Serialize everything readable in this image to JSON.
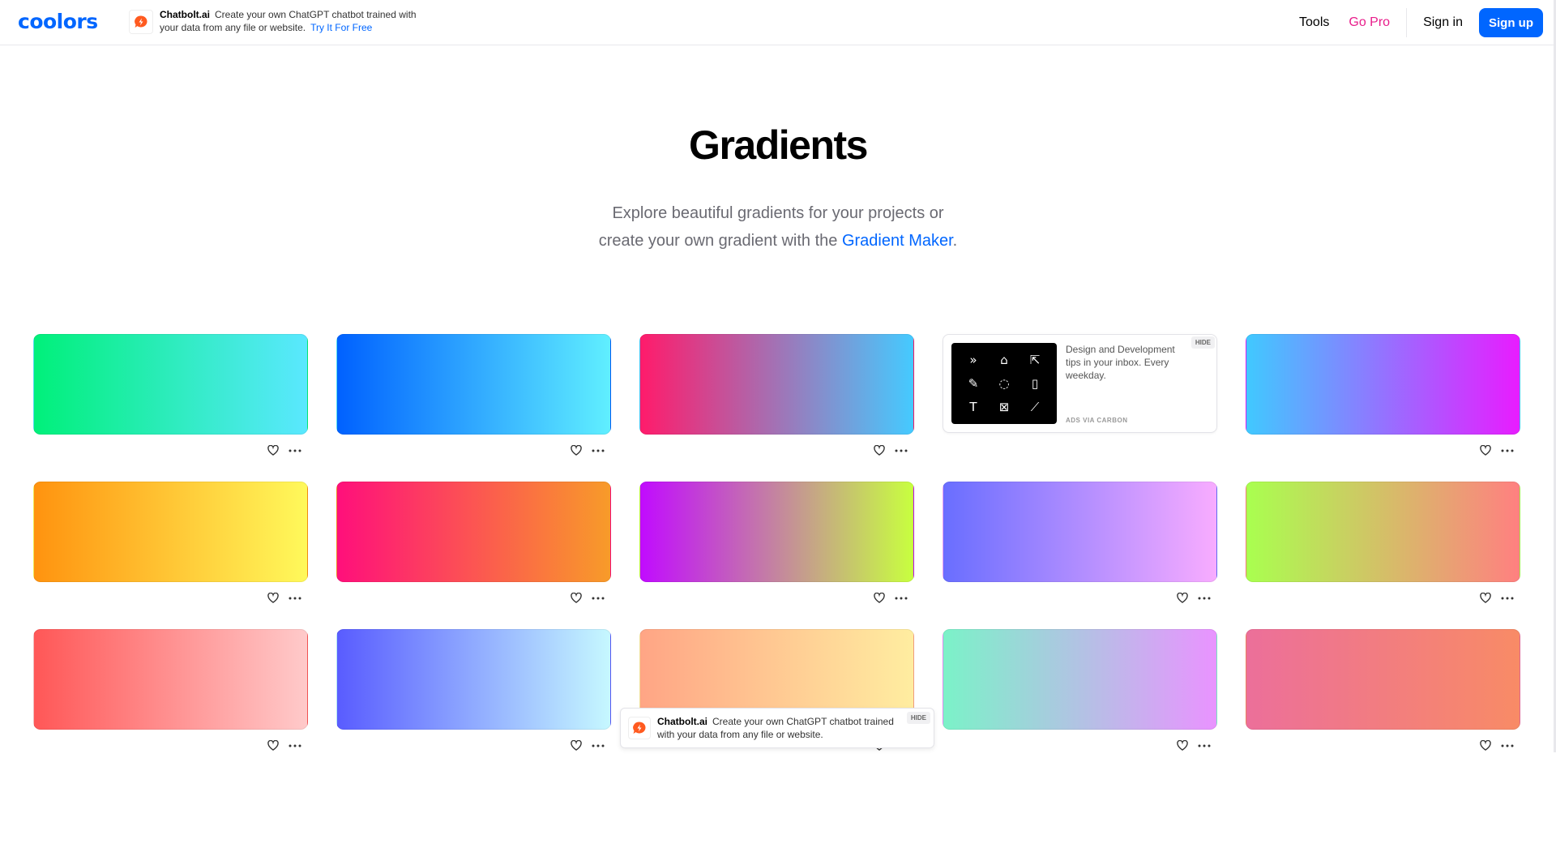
{
  "header": {
    "logo": "coolors",
    "ad": {
      "brand": "Chatbolt.ai",
      "text": "Create your own ChatGPT chatbot trained with your data from any file or website.",
      "cta": "Try It For Free"
    },
    "nav": {
      "tools": "Tools",
      "go_pro": "Go Pro",
      "sign_in": "Sign in",
      "sign_up": "Sign up"
    }
  },
  "hero": {
    "title": "Gradients",
    "line1": "Explore beautiful gradients for your projects or",
    "line2_prefix": "create your own gradient with the",
    "link": "Gradient Maker",
    "line2_suffix": "."
  },
  "gradients": [
    {
      "from": "#00F07A",
      "to": "#5AE8FF"
    },
    {
      "from": "#0061FF",
      "to": "#60EFFF"
    },
    {
      "from": "#FF1B6B",
      "to": "#45CAFF"
    },
    {
      "from": "#40C9FF",
      "to": "#E81CFF"
    },
    {
      "from": "#FF930F",
      "to": "#FFF95B"
    },
    {
      "from": "#FF0F7B",
      "to": "#F89B29"
    },
    {
      "from": "#C10BFF",
      "to": "#C8FF3F"
    },
    {
      "from": "#696EFF",
      "to": "#F8ACFF"
    },
    {
      "from": "#A9FF4F",
      "to": "#FF8080"
    },
    {
      "from": "#FF5757",
      "to": "#FFCACA"
    },
    {
      "from": "#595CFF",
      "to": "#C6F8FF"
    },
    {
      "from": "#FFA585",
      "to": "#FFEDA0"
    },
    {
      "from": "#7BF2C8",
      "to": "#E993FF"
    },
    {
      "from": "#EC6F9A",
      "to": "#F88B66"
    }
  ],
  "carbon_ad": {
    "text": "Design and Development tips in your inbox. Every weekday.",
    "via": "ADS VIA CARBON",
    "hide": "HIDE"
  },
  "float_ad": {
    "brand": "Chatbolt.ai",
    "text": "Create your own ChatGPT chatbot trained with your data from any file or website.",
    "hide": "HIDE"
  },
  "colors": {
    "accent": "#0066FF",
    "pro": "#E81E8B",
    "ad_logo": "#FF5A1F"
  },
  "icons": {
    "like": "heart-icon",
    "more": "more-dots-icon",
    "ad": "chatbolt-logo-icon"
  }
}
